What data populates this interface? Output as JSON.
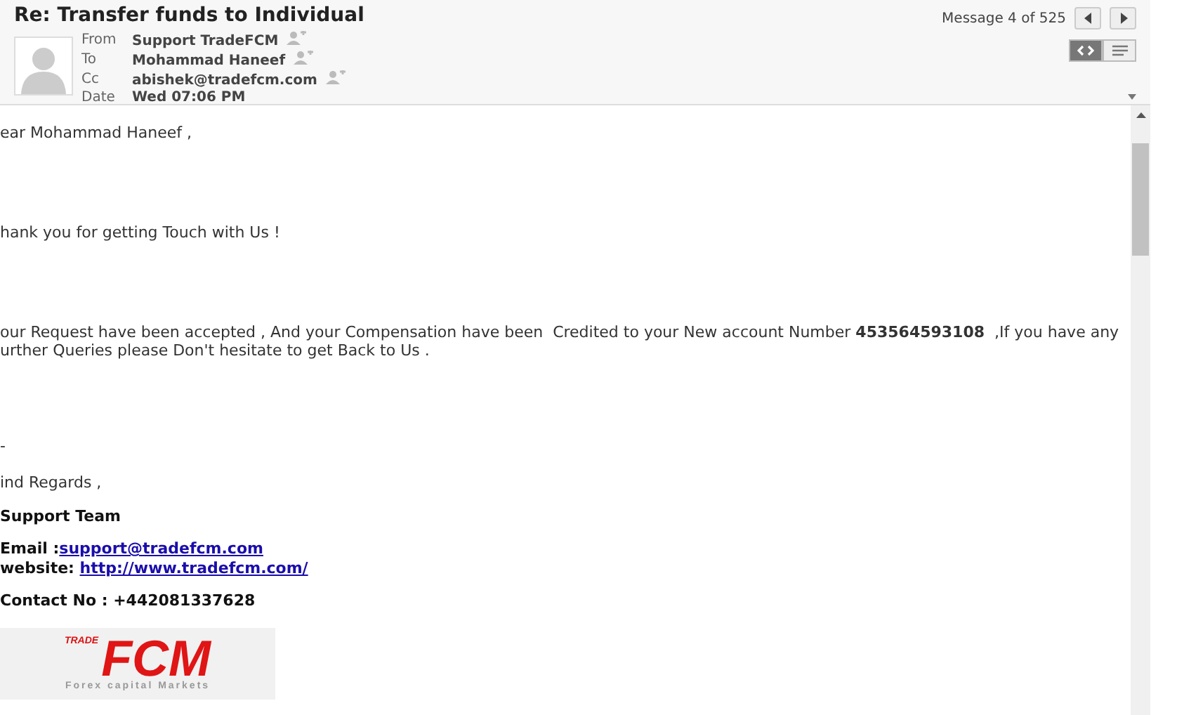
{
  "header": {
    "subject": "Re: Transfer funds to Individual",
    "fields": [
      {
        "label": "From",
        "value": "Support TradeFCM"
      },
      {
        "label": "To",
        "value": "Mohammad Haneef"
      },
      {
        "label": "Cc",
        "value": "abishek@tradefcm.com"
      },
      {
        "label": "Date",
        "value": "Wed 07:06 PM"
      }
    ],
    "counter": "Message 4 of 525",
    "view_modes": [
      {
        "kind": "html",
        "selected": true
      },
      {
        "kind": "text",
        "selected": false
      }
    ]
  },
  "body": {
    "paragraphs": [
      {
        "kind": "plain",
        "text": "ear Mohammad Haneef ,"
      },
      {
        "kind": "plain",
        "text": "hank you for getting Touch with Us !"
      },
      {
        "kind": "plain",
        "text": "our Request have been accepted , And your Compensation have been  Credited to your New account Number **453564593108**  ,If you have any\nurther Queries please Don't hesitate to get Back to Us ."
      },
      {
        "kind": "plain",
        "text": "-"
      },
      {
        "kind": "plain",
        "text": "ind Regards ,"
      },
      {
        "kind": "bold",
        "text": "Support Team"
      }
    ],
    "contacts": [
      {
        "label": "Email :",
        "link": "support@tradefcm.com"
      },
      {
        "label": "website: ",
        "link": "http://www.tradefcm.com/"
      }
    ],
    "phone": "Contact No : +442081337628",
    "logo": {
      "small": "TRADE",
      "big": "FCM",
      "tagline": "Forex capital Markets"
    }
  }
}
